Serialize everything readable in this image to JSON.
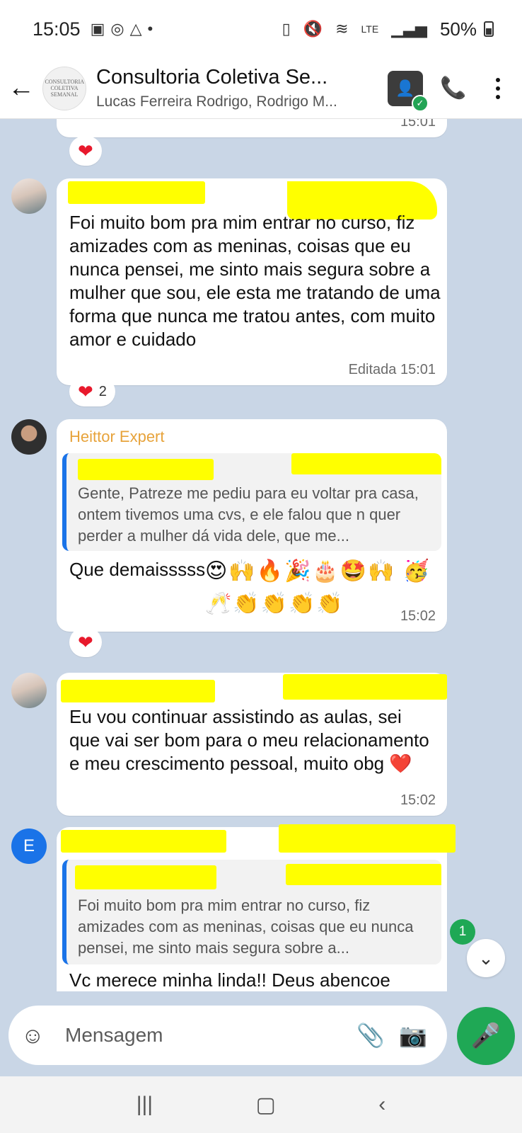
{
  "status": {
    "time": "15:05",
    "battery": "50%",
    "network": "LTE"
  },
  "header": {
    "title": "Consultoria Coletiva Se...",
    "subtitle": "Lucas Ferreira Rodrigo, Rodrigo M...",
    "group_logo_text": "CONSULTORIA COLETIVA SEMANAL"
  },
  "messages": {
    "m0": {
      "time": "15:01"
    },
    "m1": {
      "text": "Foi muito bom pra mim entrar no curso, fiz amizades com as meninas, coisas que eu nunca pensei, me sinto mais segura sobre a mulher que sou, ele esta me tratando de uma forma que nunca me tratou antes, com muito amor e cuidado",
      "meta": "Editada 15:01",
      "reaction_count": "2"
    },
    "m2": {
      "sender": "Heittor Expert",
      "quote": "Gente, Patreze me pediu para eu voltar pra casa, ontem tivemos uma cvs, e ele falou que n quer perder a mulher dá vida dele, que me...",
      "text": "Que demaisssss",
      "emojis": "😍🙌🔥🎉🎂🤩🙌 🥳🥂👏👏👏👏",
      "time": "15:02"
    },
    "m3": {
      "text": "Eu vou continuar assistindo as aulas, sei que vai ser bom para o meu relacionamento e meu crescimento pessoal, muito obg ❤️",
      "time": "15:02"
    },
    "m4": {
      "avatar_letter": "E",
      "quote": "Foi muito bom pra mim entrar no curso, fiz amizades com as meninas, coisas que eu nunca pensei, me sinto mais segura sobre a...",
      "text": "Vc merece minha linda!! Deus abencoe"
    }
  },
  "unread_badge": "1",
  "composer": {
    "placeholder": "Mensagem"
  },
  "colors": {
    "background": "#c9d6e6",
    "accent": "#1fa855",
    "sender_name": "#e7a33b",
    "quote_bar": "#1a73e8",
    "redaction": "#ffff00"
  }
}
